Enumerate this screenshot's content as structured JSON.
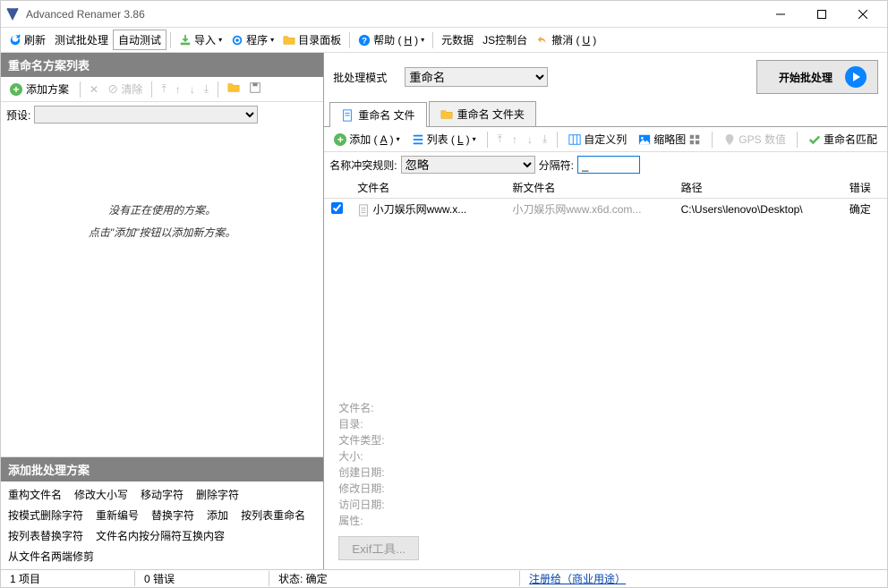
{
  "window": {
    "title": "Advanced Renamer 3.86"
  },
  "toolbar": {
    "refresh": "刷新",
    "testbatch": "测试批处理",
    "autotest": "自动测试",
    "import": "导入",
    "program": "程序",
    "dirpanel": "目录面板",
    "help": "帮助 (",
    "help_u": "H",
    "help_after": ")",
    "metadata": "元数据",
    "jsconsole": "JS控制台",
    "undo": "撤消  (",
    "undo_u": "U",
    "undo_after": ")"
  },
  "leftpanel": {
    "title": "重命名方案列表",
    "addscheme": "添加方案",
    "clear": "清除",
    "preset_label": "预设:",
    "empty1": "没有正在使用的方案。",
    "empty2": "点击\"添加\"按钮以添加新方案。"
  },
  "methods": {
    "title": "添加批处理方案",
    "items": [
      "重构文件名",
      "修改大小写",
      "移动字符",
      "删除字符",
      "按模式删除字符",
      "重新编号",
      "替换字符",
      "添加",
      "按列表重命名",
      "按列表替换字符",
      "文件名内按分隔符互换内容",
      "从文件名两端修剪"
    ]
  },
  "right": {
    "mode_label": "批处理模式",
    "mode_value": "重命名",
    "start": "开始批处理",
    "tab_files": "重命名 文件",
    "tab_folders": "重命名 文件夹",
    "add": "添加 (",
    "add_u": "A",
    "add_after": ")",
    "list": "列表 (",
    "list_u": "L",
    "list_after": ")",
    "customcol": "自定义列",
    "thumb": "缩略图",
    "gps": "GPS 数值",
    "matchrename": "重命名匹配",
    "rule_label": "名称冲突规则:",
    "rule_value": "忽略",
    "sep_label": "分隔符:",
    "sep_value": "_",
    "cols": {
      "fn": "文件名",
      "nfn": "新文件名",
      "path": "路径",
      "err": "错误"
    },
    "row": {
      "filename": "小刀娱乐网www.x...",
      "newname": "小刀娱乐网www.x6d.com...",
      "path": "C:\\Users\\lenovo\\Desktop\\",
      "error": "确定"
    }
  },
  "info": {
    "filename": "文件名:",
    "dir": "目录:",
    "type": "文件类型:",
    "size": "大小:",
    "created": "创建日期:",
    "modified": "修改日期:",
    "accessed": "访问日期:",
    "attrs": "属性:",
    "exif": "Exif工具..."
  },
  "status": {
    "items": "1 项目",
    "errors": "0 错误",
    "state": "状态: 确定",
    "register": "注册给（商业用途）"
  }
}
